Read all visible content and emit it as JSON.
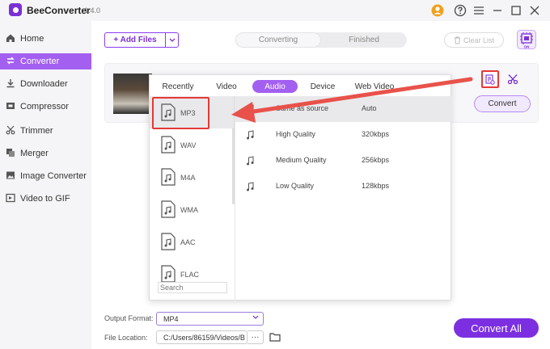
{
  "app": {
    "name": "BeeConverter",
    "version": "1.4.0"
  },
  "colors": {
    "accent": "#7c2fe0",
    "sidebar_active": "#a35ff0",
    "highlight": "#e53935"
  },
  "sidebar": {
    "items": [
      {
        "label": "Home",
        "icon": "home-icon",
        "active": false
      },
      {
        "label": "Converter",
        "icon": "converter-icon",
        "active": true
      },
      {
        "label": "Downloader",
        "icon": "download-icon",
        "active": false
      },
      {
        "label": "Compressor",
        "icon": "compress-icon",
        "active": false
      },
      {
        "label": "Trimmer",
        "icon": "scissors-icon",
        "active": false
      },
      {
        "label": "Merger",
        "icon": "merge-icon",
        "active": false
      },
      {
        "label": "Image Converter",
        "icon": "image-icon",
        "active": false
      },
      {
        "label": "Video to GIF",
        "icon": "gif-icon",
        "active": false
      }
    ]
  },
  "toolbar": {
    "add_files": "+ Add Files",
    "tabs": [
      "Converting",
      "Finished"
    ],
    "active_tab": "Converting",
    "clear_list": "Clear List"
  },
  "file_card": {
    "convert_label": "Convert"
  },
  "popup": {
    "tabs": [
      "Recently",
      "Video",
      "Audio",
      "Device",
      "Web Video"
    ],
    "active_tab": "Audio",
    "formats": [
      "MP3",
      "WAV",
      "M4A",
      "WMA",
      "AAC",
      "FLAC"
    ],
    "selected_format": "MP3",
    "search_placeholder": "Search",
    "qualities": [
      {
        "name": "Same as source",
        "value": "Auto"
      },
      {
        "name": "High Quality",
        "value": "320kbps"
      },
      {
        "name": "Medium Quality",
        "value": "256kbps"
      },
      {
        "name": "Low Quality",
        "value": "128kbps"
      }
    ]
  },
  "footer": {
    "output_format_label": "Output Format:",
    "output_format_value": "MP4",
    "file_location_label": "File Location:",
    "file_location_value": "C:/Users/86159/Videos/B",
    "more_label": "···",
    "convert_all": "Convert All"
  }
}
